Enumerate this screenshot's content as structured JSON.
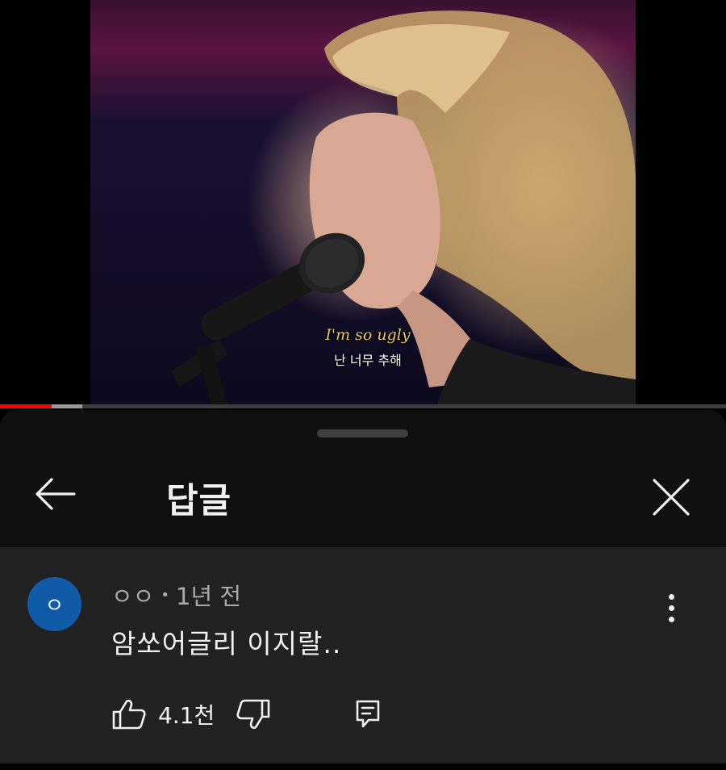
{
  "video": {
    "subtitle_en": "I'm so ugly",
    "subtitle_ko": "난 너무 추해",
    "progress_played_fraction": 0.071,
    "progress_buffered_fraction": 0.113,
    "colors": {
      "progress": "#ff0000",
      "buffer": "#9a9a9a",
      "track": "#3d3d3d"
    }
  },
  "sheet": {
    "title": "답글",
    "back_icon": "arrow-left-icon",
    "close_icon": "close-icon",
    "colors": {
      "header_bg": "#0f0f0f",
      "body_bg": "#212121",
      "text": "#f1f1f1",
      "meta": "#aaaaaa"
    }
  },
  "comment": {
    "avatar_letter": "ㅇ",
    "avatar_color": "#0f5ba7",
    "author": "ㅇㅇ",
    "separator": "•",
    "time": "1년 전",
    "text": "암쏘어글리 이지랄..",
    "like_count": "4.1천",
    "icons": {
      "like": "thumbs-up-icon",
      "dislike": "thumbs-down-icon",
      "reply": "reply-icon",
      "more": "more-vertical-icon"
    }
  }
}
